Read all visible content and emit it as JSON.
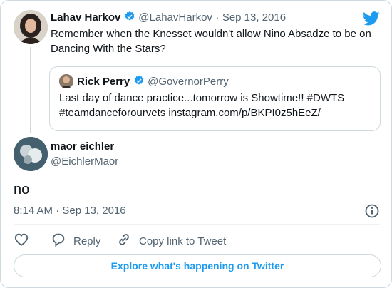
{
  "parent_tweet": {
    "display_name": "Lahav Harkov",
    "handle": "@LahavHarkov",
    "separator": "·",
    "date": "Sep 13, 2016",
    "text_line1": "Remember when the Knesset wouldn't allow Nino Absadze to be on",
    "text_line2": "Dancing With the Stars?"
  },
  "quoted_tweet": {
    "display_name": "Rick Perry",
    "handle": "@GovernorPerry",
    "text_line1": "Last day of dance practice...tomorrow is Showtime!! #DWTS",
    "text_line2": "#teamdanceforourvets instagram.com/p/BKPI0z5hEeZ/"
  },
  "reply_tweet": {
    "display_name": "maor eichler",
    "handle": "@EichlerMaor",
    "text": "no",
    "timestamp": "8:14 AM · Sep 13, 2016"
  },
  "actions": {
    "reply_label": "Reply",
    "copy_link_label": "Copy link to Tweet"
  },
  "explore_label": "Explore what's happening on Twitter",
  "colors": {
    "accent": "#1d9bf0",
    "muted": "#536471",
    "border": "#cfd9de"
  },
  "icons": [
    "twitter-bird-icon",
    "verified-badge-icon",
    "info-icon",
    "heart-icon",
    "reply-icon",
    "link-icon"
  ]
}
